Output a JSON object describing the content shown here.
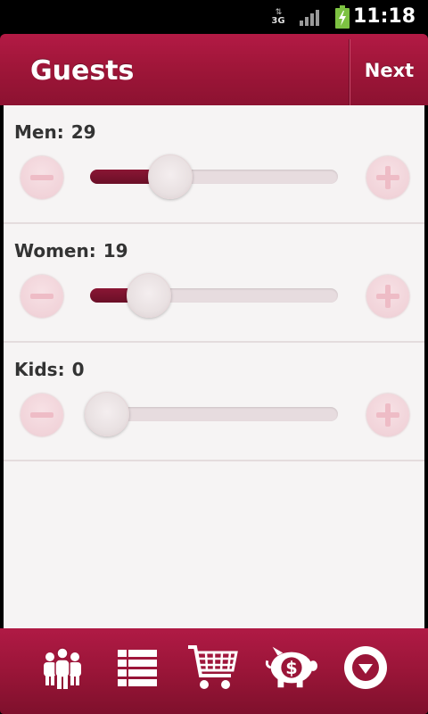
{
  "status_bar": {
    "network_arrows": "⇅",
    "network_type": "3G",
    "signal_icon": "signal-icon",
    "battery_icon": "battery-charging-icon",
    "time": "11:18"
  },
  "header": {
    "title": "Guests",
    "next_label": "Next"
  },
  "rows": [
    {
      "label": "Men:",
      "value": "29",
      "level": 0.29
    },
    {
      "label": "Women:",
      "value": "19",
      "level": 0.19
    },
    {
      "label": "Kids:",
      "value": "0",
      "level": 0.0
    }
  ],
  "tabs": [
    {
      "icon": "guests-icon"
    },
    {
      "icon": "list-icon"
    },
    {
      "icon": "cart-icon"
    },
    {
      "icon": "piggy-bank-icon"
    },
    {
      "icon": "more-icon"
    }
  ],
  "colors": {
    "accent": "#a01639",
    "accent_dark": "#6a0f27",
    "background": "#f6f4f4"
  }
}
